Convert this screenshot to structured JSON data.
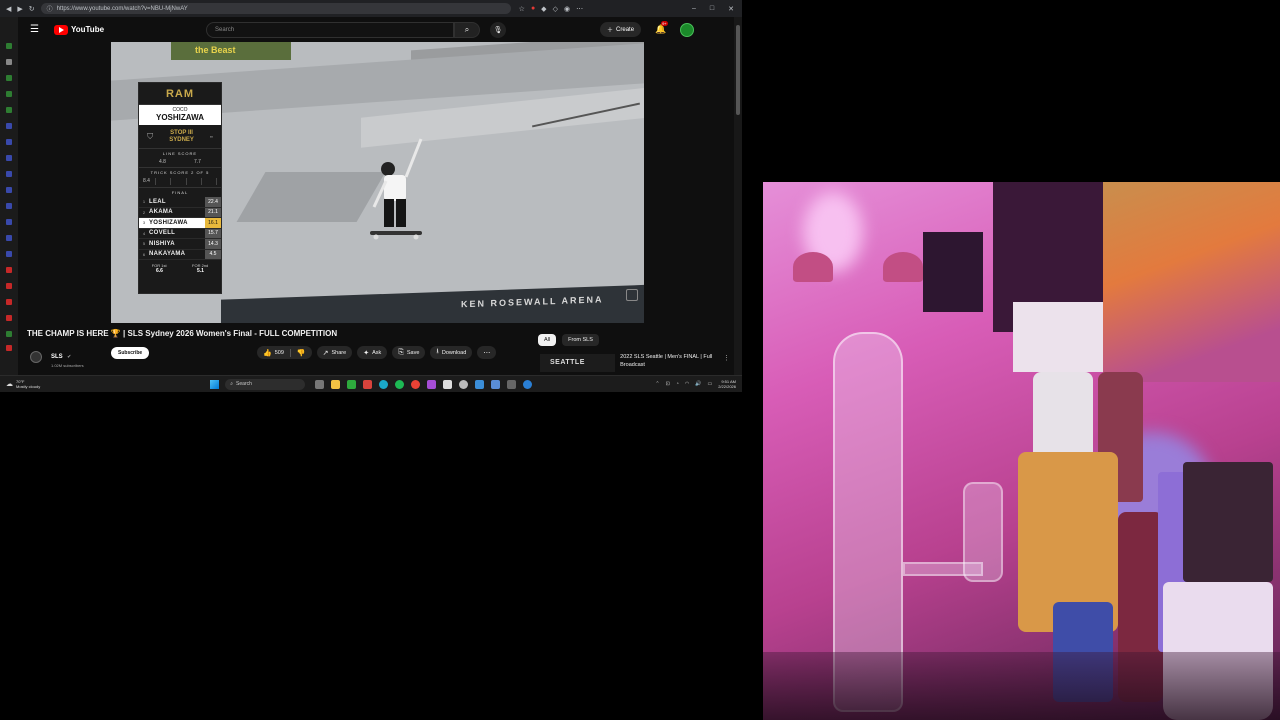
{
  "browser": {
    "url": "https://www.youtube.com/watch?v=NBU-MjNwAY"
  },
  "header": {
    "logo_text": "YouTube",
    "search_placeholder": "Search",
    "create_label": "Create",
    "notification_count": "9+"
  },
  "scoreboard": {
    "brand": "RAM",
    "first_name": "COCO",
    "last_name": "YOSHIZAWA",
    "event_line1": "STOP III",
    "event_line2": "SYDNEY",
    "line_score_label": "LINE SCORE",
    "line_scores": [
      "4.8",
      "7.7"
    ],
    "trick_score_label": "TRICK SCORE 2 OF 5",
    "trick_scores": [
      "8.4",
      "",
      "",
      "",
      ""
    ],
    "final_label": "FINAL",
    "standings": [
      {
        "rank": "1",
        "name": "LEAL",
        "score": "22.4",
        "highlight": false
      },
      {
        "rank": "2",
        "name": "AKAMA",
        "score": "21.1",
        "highlight": false
      },
      {
        "rank": "3",
        "name": "YOSHIZAWA",
        "score": "16.1",
        "highlight": true
      },
      {
        "rank": "4",
        "name": "COVELL",
        "score": "15.7",
        "highlight": false
      },
      {
        "rank": "5",
        "name": "NISHIYA",
        "score": "14.3",
        "highlight": false
      },
      {
        "rank": "6",
        "name": "NAKAYAMA",
        "score": "4.5",
        "highlight": false
      }
    ],
    "for_first_label": "FOR 1st",
    "for_second_label": "FOR 2nd",
    "for_first_value": "6.6",
    "for_second_value": "5.1"
  },
  "video": {
    "title": "THE CHAMP IS HERE 🏆 | SLS Sydney 2026 Women's Final - FULL COMPETITION",
    "top_banner": "the Beast",
    "arena_text": "KEN ROSEWALL ARENA",
    "channel_name": "SLS",
    "channel_subs": "1.02M subscribers",
    "subscribe_label": "Subscribe",
    "like_count": "509",
    "share_label": "Share",
    "ask_label": "Ask",
    "save_label": "Save",
    "download_label": "Download"
  },
  "recommendations": {
    "chips": [
      {
        "label": "All",
        "active": true
      },
      {
        "label": "From SLS",
        "active": false
      }
    ],
    "items": [
      {
        "thumb_text": "SEATTLE",
        "title": "2022 SLS Seattle | Men's FINAL | Full Broadcast"
      }
    ]
  },
  "taskbar": {
    "weather_temp": "70°F",
    "weather_desc": "Mostly cloudy",
    "search_label": "Search",
    "time": "9:51 AM",
    "date": "2/22/2026"
  },
  "colors": {
    "yt_red": "#ff0000",
    "score_highlight": "#e9b93c",
    "webcam_tint": "#d85db7"
  }
}
